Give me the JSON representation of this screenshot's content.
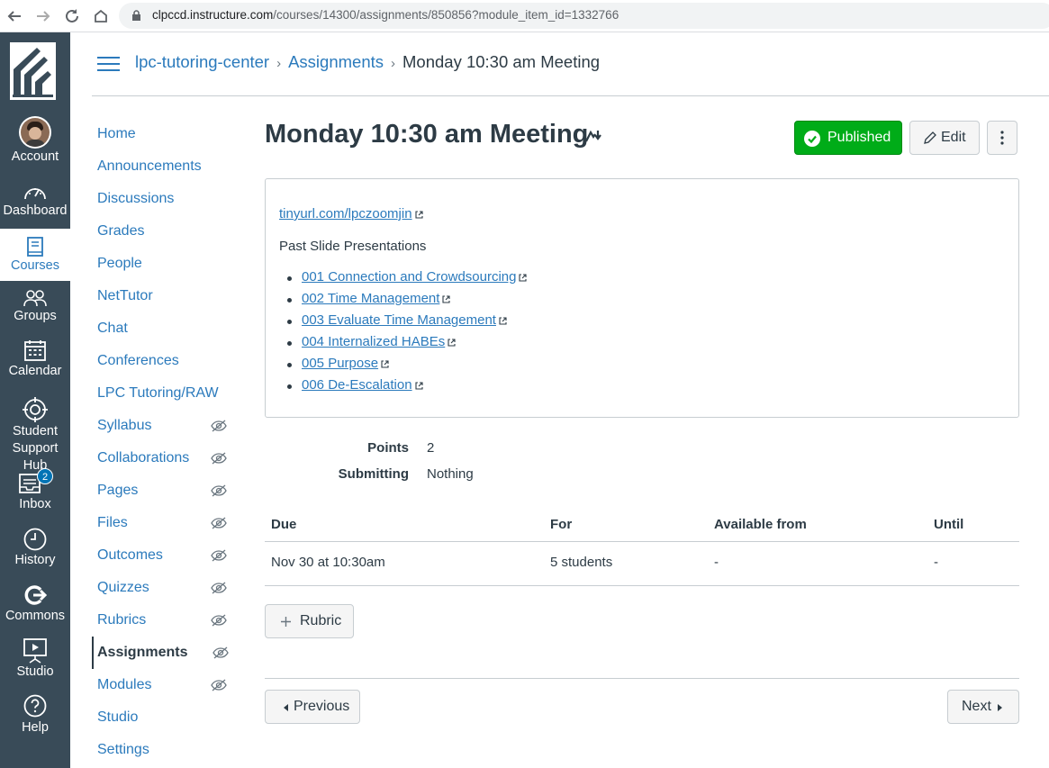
{
  "browser": {
    "url_host": "clpccd.instructure.com",
    "url_path": "/courses/14300/assignments/850856?module_item_id=1332766"
  },
  "global_nav": {
    "items": [
      {
        "label": "Account",
        "icon": "avatar"
      },
      {
        "label": "Dashboard",
        "icon": "dashboard-icon"
      },
      {
        "label": "Courses",
        "icon": "courses-icon"
      },
      {
        "label": "Groups",
        "icon": "groups-icon"
      },
      {
        "label": "Calendar",
        "icon": "calendar-icon"
      },
      {
        "label": "Student Support Hub",
        "label_line1": "Student",
        "label_line2": "Support Hub",
        "icon": "support-hub-icon"
      },
      {
        "label": "Inbox",
        "icon": "inbox-icon",
        "badge": "2"
      },
      {
        "label": "History",
        "icon": "history-icon"
      },
      {
        "label": "Commons",
        "icon": "commons-icon"
      },
      {
        "label": "Studio",
        "icon": "studio-icon"
      },
      {
        "label": "Help",
        "icon": "help-icon"
      }
    ],
    "active": "Courses",
    "bg_color": "#394b58"
  },
  "breadcrumb": {
    "course": "lpc-tutoring-center",
    "section": "Assignments",
    "current": "Monday 10:30 am Meeting"
  },
  "course_nav": [
    {
      "label": "Home",
      "hidden": false
    },
    {
      "label": "Announcements",
      "hidden": false
    },
    {
      "label": "Discussions",
      "hidden": false
    },
    {
      "label": "Grades",
      "hidden": false
    },
    {
      "label": "People",
      "hidden": false
    },
    {
      "label": "NetTutor",
      "hidden": false
    },
    {
      "label": "Chat",
      "hidden": false
    },
    {
      "label": "Conferences",
      "hidden": false
    },
    {
      "label": "LPC Tutoring/RAW",
      "hidden": false
    },
    {
      "label": "Syllabus",
      "hidden": true
    },
    {
      "label": "Collaborations",
      "hidden": true
    },
    {
      "label": "Pages",
      "hidden": true
    },
    {
      "label": "Files",
      "hidden": true
    },
    {
      "label": "Outcomes",
      "hidden": true
    },
    {
      "label": "Quizzes",
      "hidden": true
    },
    {
      "label": "Rubrics",
      "hidden": true
    },
    {
      "label": "Assignments",
      "hidden": true,
      "active": true
    },
    {
      "label": "Modules",
      "hidden": true
    },
    {
      "label": "Studio",
      "hidden": false
    },
    {
      "label": "Settings",
      "hidden": false
    }
  ],
  "assignment": {
    "title": "Monday 10:30 am Meeting",
    "published_label": "Published",
    "edit_label": "Edit",
    "link": "tinyurl.com/lpczoomjin",
    "subheading": "Past Slide Presentations",
    "presentations": [
      "001 Connection and Crowdsourcing",
      "002 Time Management",
      "003 Evaluate Time Management",
      "004 Internalized HABEs",
      "005 Purpose",
      "006 De-Escalation"
    ],
    "points_label": "Points",
    "points_value": "2",
    "submitting_label": "Submitting",
    "submitting_value": "Nothing"
  },
  "dates_table": {
    "headers": [
      "Due",
      "For",
      "Available from",
      "Until"
    ],
    "row": [
      "Nov 30 at 10:30am",
      "5 students",
      "-",
      "-"
    ]
  },
  "rubric_button": "Rubric",
  "pagination": {
    "previous": "Previous",
    "next": "Next"
  },
  "colors": {
    "link": "#2b7abc",
    "published": "#00ac18",
    "text": "#2d3b45"
  }
}
